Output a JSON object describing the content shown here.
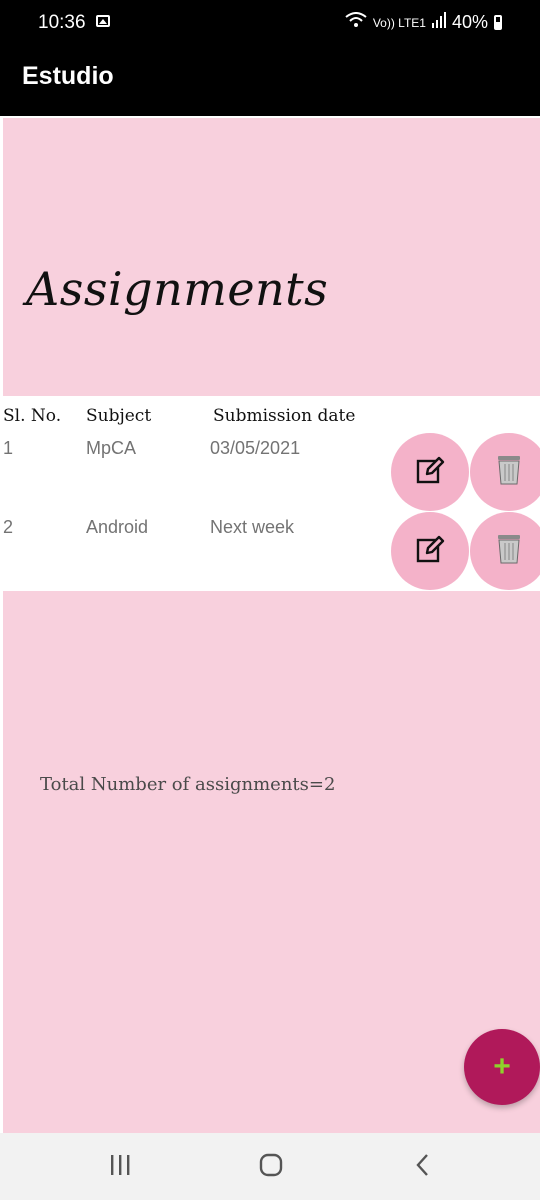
{
  "status_bar": {
    "time": "10:36",
    "network": "Vo)) LTE1",
    "battery": "40%"
  },
  "app_bar": {
    "title": "Estudio"
  },
  "header": {
    "title": "Assignments"
  },
  "table": {
    "headers": [
      "Sl. No.",
      "Subject",
      "Submission date"
    ],
    "rows": [
      {
        "sl_no": "1",
        "subject": "MpCA",
        "date": "03/05/2021"
      },
      {
        "sl_no": "2",
        "subject": "Android",
        "date": "Next week"
      }
    ]
  },
  "footer": {
    "total_text": "Total Number of assignments=2"
  },
  "fab": {
    "label": "+"
  },
  "colors": {
    "panel": "#f8d0dd",
    "action_button": "#f4b2c9",
    "fab": "#b0195a",
    "fab_plus": "#8ed22b"
  },
  "icons": {
    "edit": "edit-icon",
    "delete": "trash-icon",
    "recents": "recents-icon",
    "home": "home-icon",
    "back": "back-icon"
  }
}
